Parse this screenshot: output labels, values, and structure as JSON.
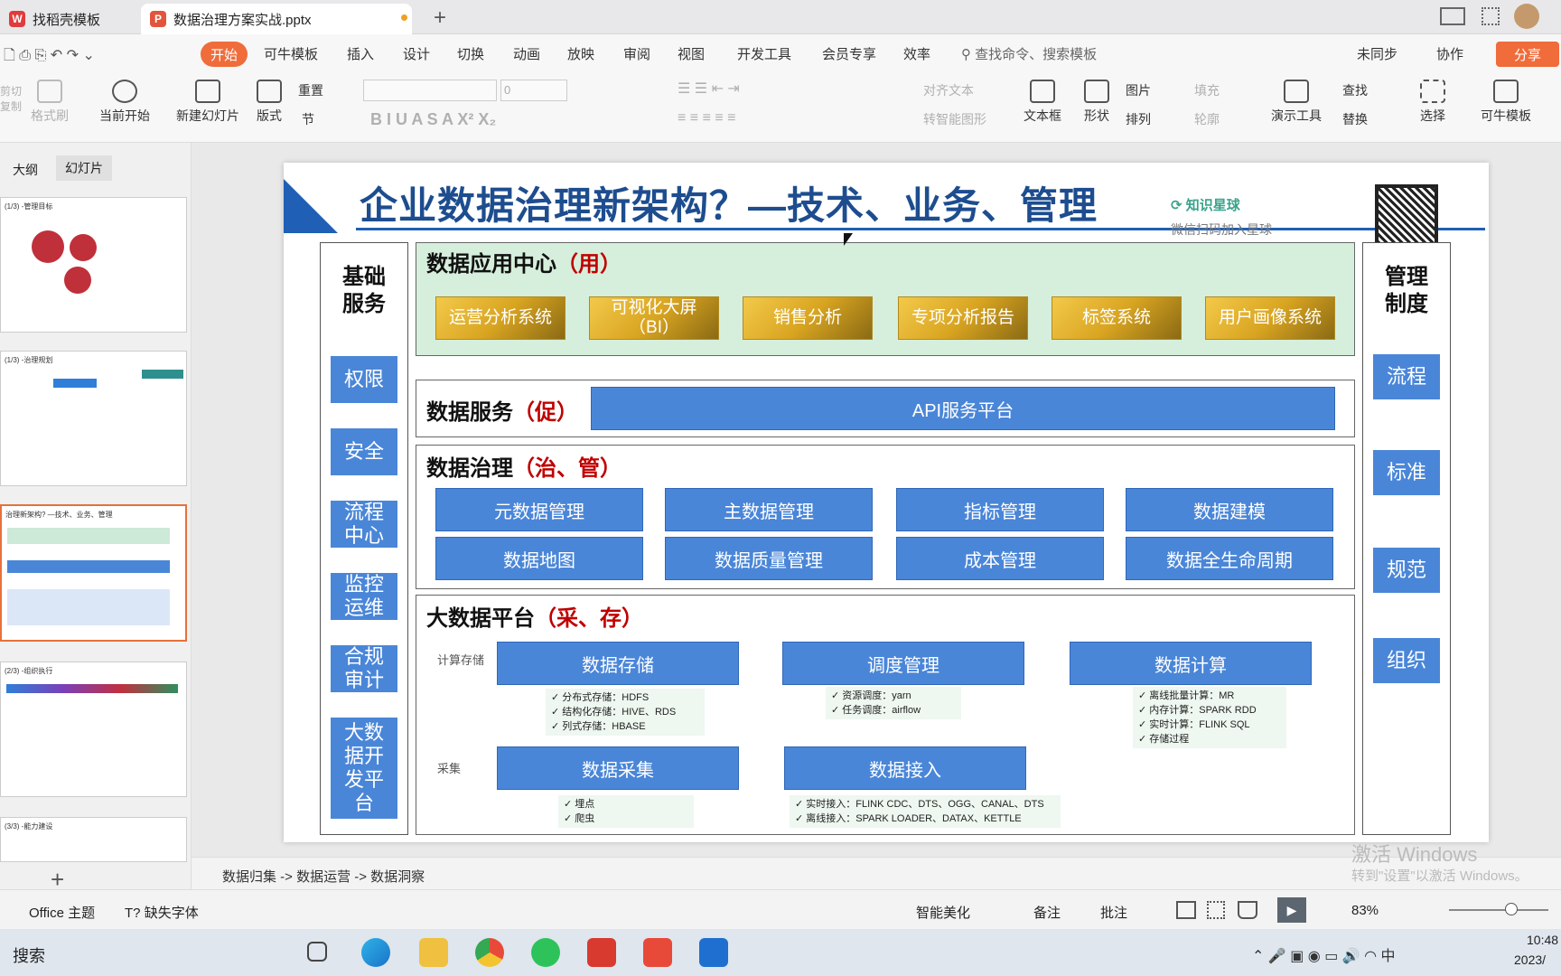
{
  "tabs": [
    {
      "label": "找稻壳模板"
    },
    {
      "label": "数据治理方案实战.pptx"
    }
  ],
  "menu": [
    "开始",
    "可牛模板",
    "插入",
    "设计",
    "切换",
    "动画",
    "放映",
    "审阅",
    "视图",
    "开发工具",
    "会员专享",
    "效率"
  ],
  "search_placeholder": "查找命令、搜索模板",
  "top_right": {
    "sync": "未同步",
    "collab": "协作",
    "share": "分享"
  },
  "ribbon": {
    "cut": "剪切",
    "copy": "复制",
    "format_painter": "格式刷",
    "play_current": "当前开始",
    "new_slide": "新建幻灯片",
    "layout": "版式",
    "reset": "重置",
    "section": "节",
    "font_size": "0",
    "align_text": "对齐文本",
    "convert_shape": "转智能图形",
    "textbox": "文本框",
    "shape": "形状",
    "image": "图片",
    "fill": "填充",
    "arrange": "排列",
    "outline": "轮廓",
    "present_tool": "演示工具",
    "find": "查找",
    "replace": "替换",
    "select": "选择",
    "template": "可牛模板"
  },
  "panel_tabs": {
    "outline": "大纲",
    "slides": "幻灯片"
  },
  "thumbs": [
    "(1/3) -管理目标",
    "(1/3) -治理规划",
    "治理新架构? —技术、业务、管理",
    "(2/3) -组织执行",
    "(3/3) -能力建设"
  ],
  "slide": {
    "title": "企业数据治理新架构？—技术、业务、管理",
    "watermark": {
      "name": "知识星球",
      "hint": "微信扫码加入星球"
    },
    "left_col": {
      "title": "基础\n服务",
      "items": [
        "权限",
        "安全",
        "流程\n中心",
        "监控\n运维",
        "合规\n审计",
        "大数\n据开\n发平\n台"
      ]
    },
    "right_col": {
      "title": "管理\n制度",
      "items": [
        "流程",
        "标准",
        "规范",
        "组织"
      ]
    },
    "app_center": {
      "title": "数据应用中心",
      "tag": "（用）",
      "items": [
        "运营分析系统",
        "可视化大屏\n（BI）",
        "销售分析",
        "专项分析报告",
        "标签系统",
        "用户画像系统"
      ]
    },
    "service": {
      "title": "数据服务",
      "tag": "（促）",
      "item": "API服务平台"
    },
    "governance": {
      "title": "数据治理",
      "tag": "（治、管）",
      "items": [
        "元数据管理",
        "主数据管理",
        "指标管理",
        "数据建模",
        "数据地图",
        "数据质量管理",
        "成本管理",
        "数据全生命周期"
      ]
    },
    "platform": {
      "title": "大数据平台",
      "tag": "（采、存）",
      "label_compute": "计算存储",
      "label_collect": "采集",
      "storage": {
        "name": "数据存储",
        "notes": [
          "✓  分布式存储：HDFS",
          "✓  结构化存储：HIVE、RDS",
          "✓  列式存储：HBASE"
        ]
      },
      "schedule": {
        "name": "调度管理",
        "notes": [
          "✓  资源调度：yarn",
          "✓  任务调度：airflow"
        ]
      },
      "compute": {
        "name": "数据计算",
        "notes": [
          "✓  离线批量计算：MR",
          "✓  内存计算：SPARK RDD",
          "✓  实时计算：FLINK SQL",
          "✓  存储过程"
        ]
      },
      "collect": {
        "name": "数据采集",
        "notes": [
          "✓  埋点",
          "✓  爬虫"
        ]
      },
      "ingest": {
        "name": "数据接入",
        "notes": [
          "✓  实时接入：FLINK CDC、DTS、OGG、CANAL、DTS",
          "✓  离线接入：SPARK LOADER、DATAX、KETTLE"
        ]
      }
    }
  },
  "notes_text": "数据归集 -> 数据运营 -> 数据洞察",
  "status": {
    "theme": "Office 主题",
    "missing_font": "缺失字体",
    "beautify": "智能美化",
    "notes": "备注",
    "comment": "批注",
    "zoom": "83%"
  },
  "taskbar": {
    "search": "搜索",
    "time": "10:48",
    "date": "2023/"
  },
  "win_watermark": {
    "line1": "激活 Windows",
    "line2": "转到\"设置\"以激活 Windows。"
  }
}
